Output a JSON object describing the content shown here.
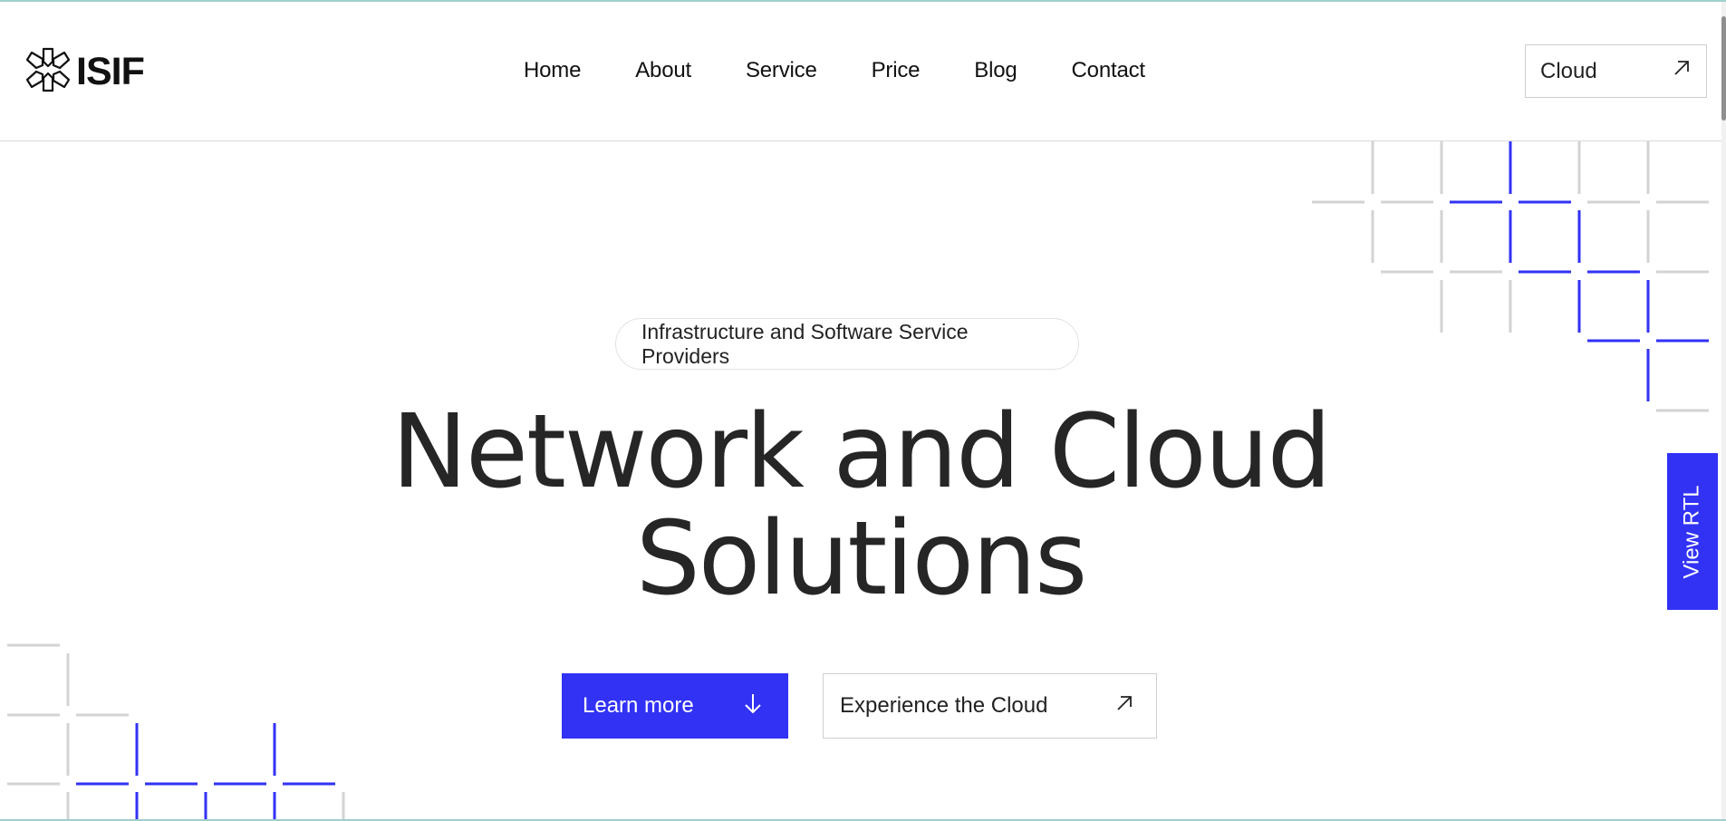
{
  "header": {
    "logo_text": "ISIF",
    "nav": [
      "Home",
      "About",
      "Service",
      "Price",
      "Blog",
      "Contact"
    ],
    "cloud_button": "Cloud"
  },
  "hero": {
    "badge": "Infrastructure and Software Service Providers",
    "title_line1": "Network and Cloud",
    "title_line2": "Solutions",
    "primary_button": "Learn more",
    "secondary_button": "Experience the Cloud"
  },
  "side_tab": {
    "label": "View RTL"
  },
  "colors": {
    "accent": "#3232f5",
    "grid_gray": "#d3d3d3",
    "text": "#222222"
  },
  "icons": {
    "logo": "asterisk-snowflake-icon",
    "cloud_button": "arrow-up-right-icon",
    "primary_button": "arrow-down-icon",
    "secondary_button": "arrow-up-right-icon"
  }
}
